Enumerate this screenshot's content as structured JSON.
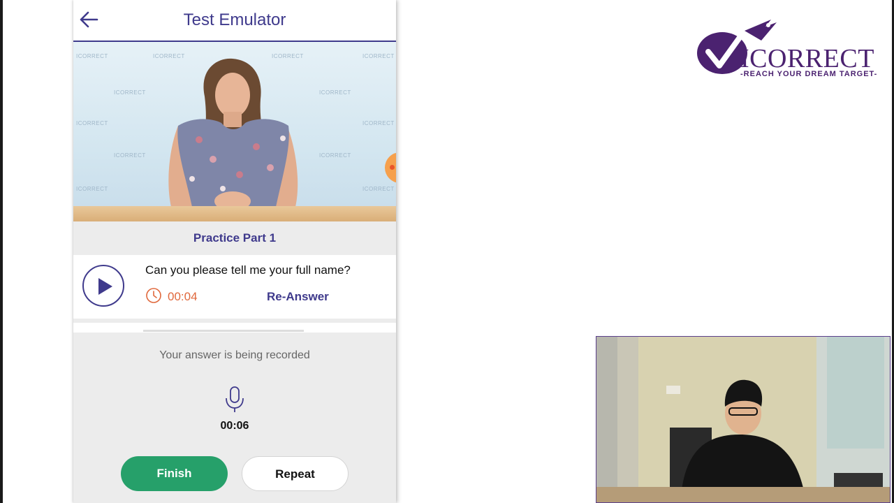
{
  "app": {
    "title": "Test Emulator",
    "back_icon": "arrow-left-icon",
    "accent_color": "#3f3a8c"
  },
  "video": {
    "watermark": "ICORRECT"
  },
  "section": {
    "title": "Practice Part 1"
  },
  "question": {
    "text": "Can you please tell me your full name?",
    "time": "00:04",
    "reanswer_label": "Re-Answer"
  },
  "recording": {
    "status": "Your answer is being recorded",
    "time": "00:06",
    "finish_label": "Finish",
    "repeat_label": "Repeat"
  },
  "brand": {
    "name": "ICORRECT",
    "tagline": "-REACH YOUR DREAM TARGET-",
    "color": "#4b2270"
  }
}
